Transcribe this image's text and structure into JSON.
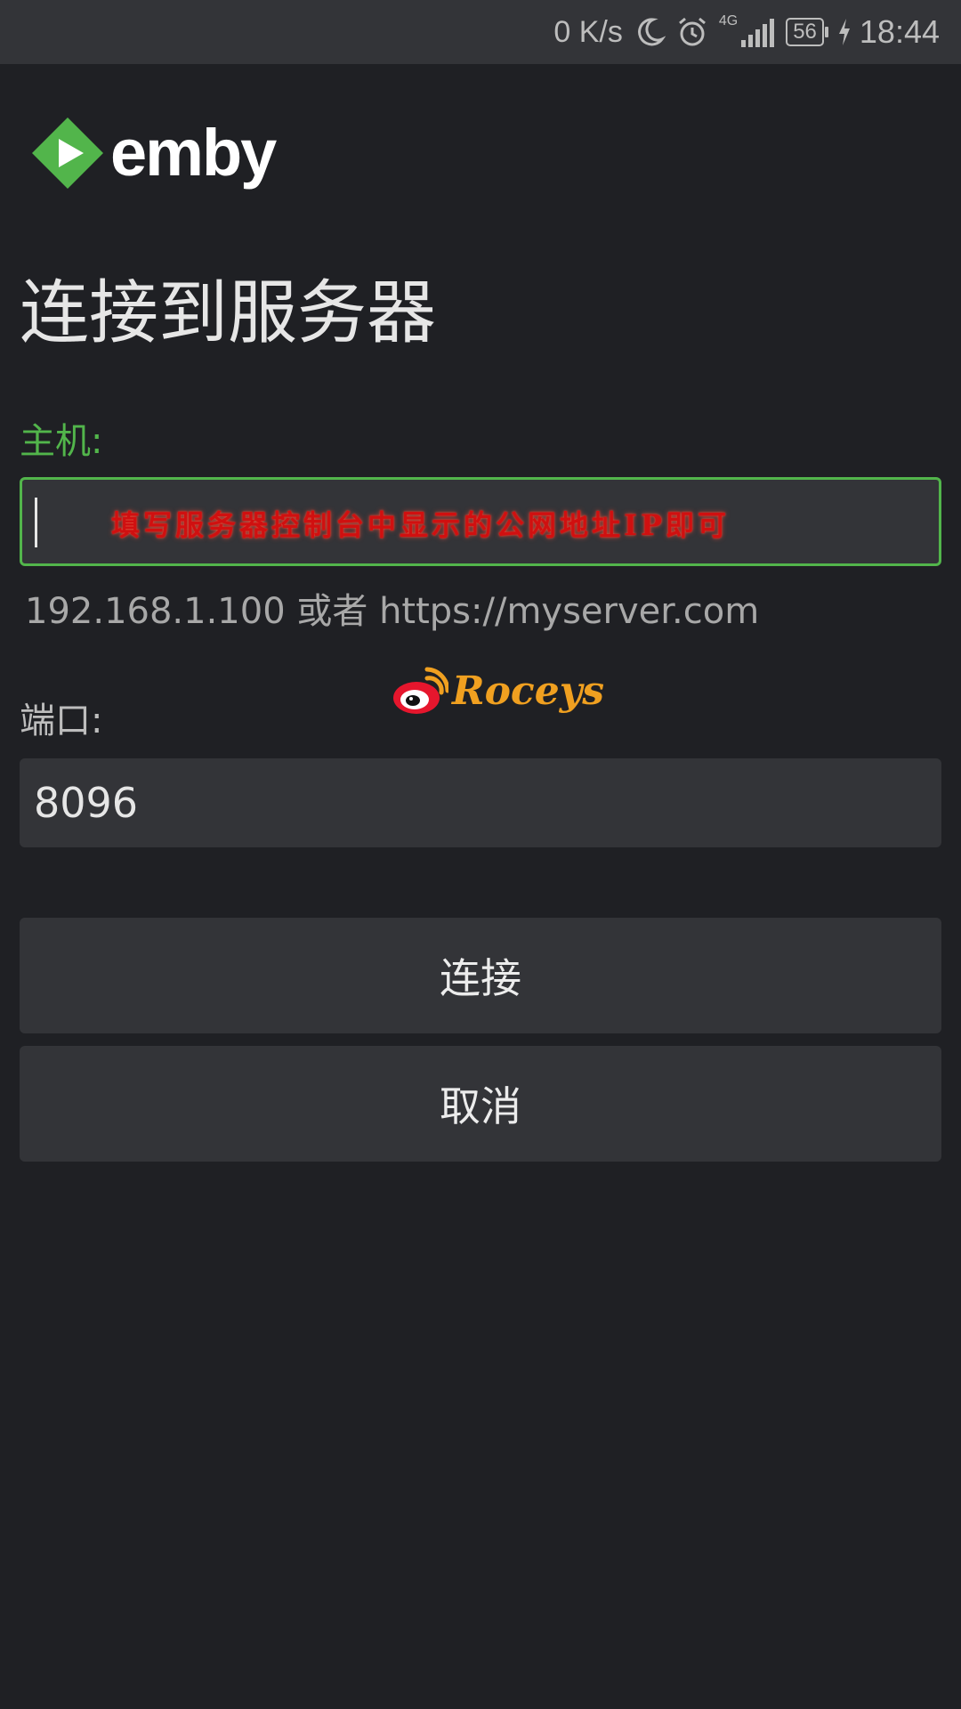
{
  "status_bar": {
    "net_speed": "0 K/s",
    "network_type": "4G",
    "battery_level": "56",
    "time": "18:44",
    "icons": [
      "moon-icon",
      "alarm-icon",
      "signal-icon",
      "battery-icon",
      "charging-icon"
    ]
  },
  "app": {
    "logo_text": "emby",
    "brand_color": "#52b54b"
  },
  "page": {
    "title": "连接到服务器"
  },
  "form": {
    "host_label": "主机:",
    "host_value": "",
    "host_annotation": "填写服务器控制台中显示的公网地址IP即可",
    "host_hint": "192.168.1.100 或者 https://myserver.com",
    "port_label": "端口:",
    "port_value": "8096"
  },
  "buttons": {
    "connect": "连接",
    "cancel": "取消"
  },
  "watermark": {
    "text": "Roceys",
    "icon": "weibo-icon"
  }
}
